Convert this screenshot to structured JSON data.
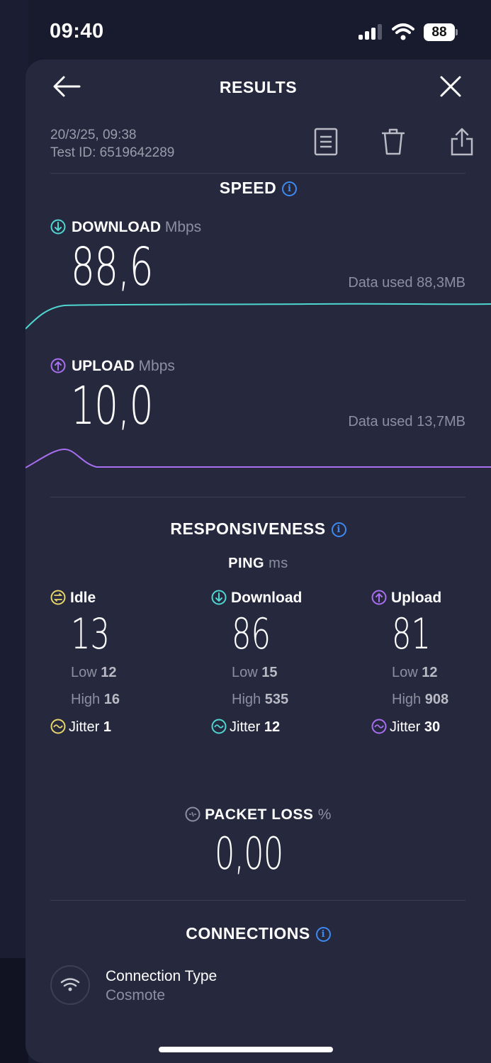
{
  "status_bar": {
    "time": "09:40",
    "battery": "88"
  },
  "header": {
    "title": "RESULTS"
  },
  "meta": {
    "date": "20/3/25, 09:38",
    "test_id": "Test ID: 6519642289"
  },
  "speed": {
    "title": "SPEED",
    "download": {
      "label": "DOWNLOAD",
      "unit": "Mbps",
      "value": "88,6",
      "data_used": "Data used 88,3MB",
      "color": "#4fd6d0"
    },
    "upload": {
      "label": "UPLOAD",
      "unit": "Mbps",
      "value": "10,0",
      "data_used": "Data used 13,7MB",
      "color": "#a86ff0"
    }
  },
  "responsiveness": {
    "title": "RESPONSIVENESS",
    "ping_label": "PING",
    "ping_unit": "ms",
    "idle": {
      "label": "Idle",
      "value": "13",
      "low_label": "Low",
      "low": "12",
      "high_label": "High",
      "high": "16",
      "jitter_label": "Jitter",
      "jitter": "1",
      "color": "#e8d56a"
    },
    "download": {
      "label": "Download",
      "value": "86",
      "low_label": "Low",
      "low": "15",
      "high_label": "High",
      "high": "535",
      "jitter_label": "Jitter",
      "jitter": "12",
      "color": "#4fd6d0"
    },
    "upload": {
      "label": "Upload",
      "value": "81",
      "low_label": "Low",
      "low": "12",
      "high_label": "High",
      "high": "908",
      "jitter_label": "Jitter",
      "jitter": "30",
      "color": "#a86ff0"
    },
    "packet_loss": {
      "label": "PACKET LOSS",
      "unit": "%",
      "value": "0,00"
    }
  },
  "connections": {
    "title": "CONNECTIONS",
    "connection_type_label": "Connection Type",
    "connection_type_value": "Cosmote"
  },
  "colors": {
    "accent_blue": "#3d8bf2",
    "background": "#26283e"
  }
}
